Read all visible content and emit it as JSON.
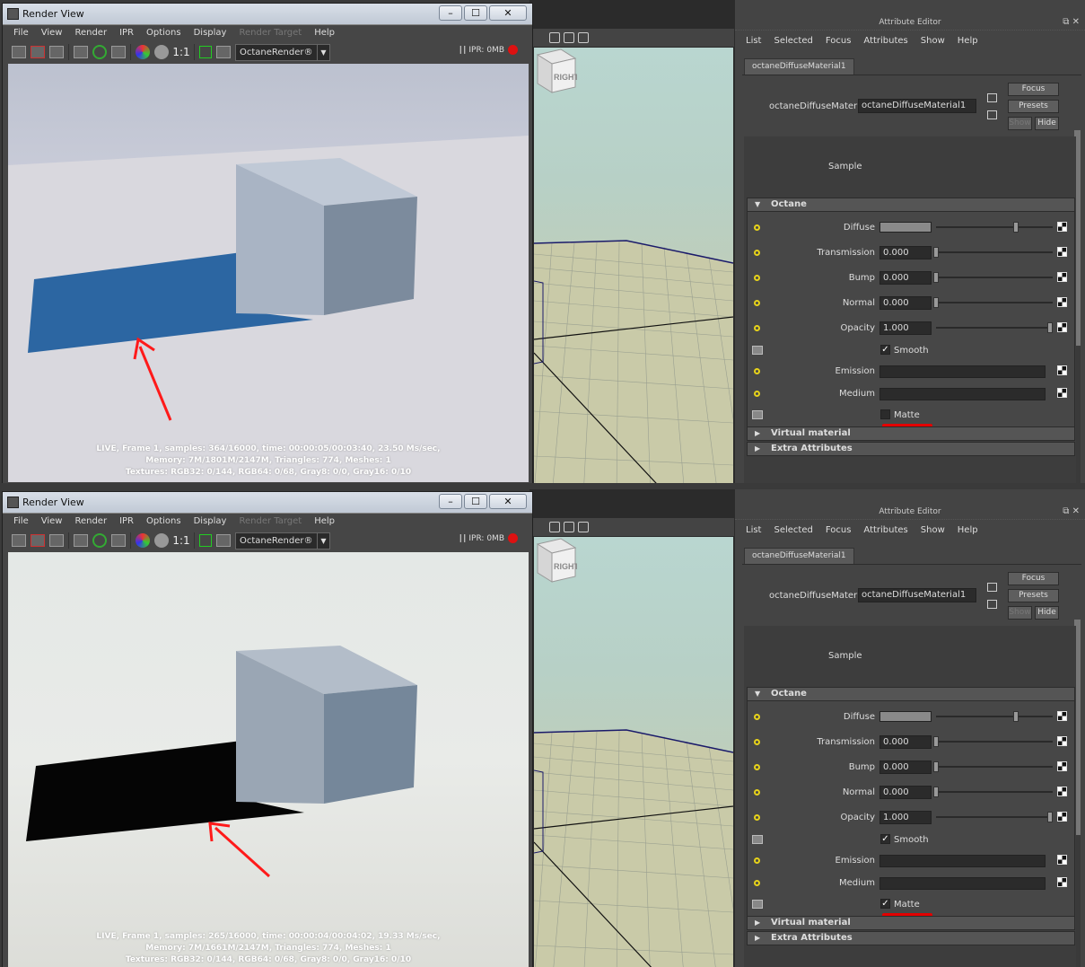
{
  "render_view": {
    "title": "Render View",
    "window_buttons": {
      "minimize": "–",
      "maximize": "☐",
      "close": "✕"
    },
    "menu": [
      "File",
      "View",
      "Render",
      "IPR",
      "Options",
      "Display",
      "Render Target",
      "Help"
    ],
    "renderer_select": "OctaneRender®",
    "zoom_label": "1:1",
    "ipr_label": "IPR: 0MB"
  },
  "attribute_editor": {
    "title": "Attribute Editor",
    "menu": [
      "List",
      "Selected",
      "Focus",
      "Attributes",
      "Show",
      "Help"
    ],
    "tab": "octaneDiffuseMaterial1",
    "node_type_label": "octaneDiffuseMaterial:",
    "node_name": "octaneDiffuseMaterial1",
    "buttons": {
      "focus": "Focus",
      "presets": "Presets",
      "show": "Show",
      "hide": "Hide"
    },
    "sample_label": "Sample",
    "section_octane": "Octane",
    "attrs": {
      "diffuse": "Diffuse",
      "transmission": "Transmission",
      "transmission_value": "0.000",
      "bump": "Bump",
      "bump_value": "0.000",
      "normal": "Normal",
      "normal_value": "0.000",
      "opacity": "Opacity",
      "opacity_value": "1.000",
      "smooth": "Smooth",
      "emission": "Emission",
      "medium": "Medium",
      "matte": "Matte"
    },
    "section_virtual": "Virtual material",
    "section_extra": "Extra Attributes"
  },
  "viewport": {
    "cube_label": "RIGHT"
  },
  "panels": [
    {
      "matte_checked": false,
      "checkmark": "",
      "stats": [
        "LIVE, Frame 1, samples: 364/16000, time: 00:00:05/00:03:40, 23.50 Ms/sec,",
        "Memory: 7M/1801M/2147M, Triangles: 774, Meshes: 1",
        "Textures: RGB32: 0/144, RGB64: 0/68, Gray8: 0/0, Gray16: 0/10"
      ]
    },
    {
      "matte_checked": true,
      "checkmark": "✓",
      "stats": [
        "LIVE, Frame 1, samples: 265/16000, time: 00:00:04/00:04:02, 19.33 Ms/sec,",
        "Memory: 7M/1661M/2147M, Triangles: 774, Meshes: 1",
        "Textures: RGB32: 0/144, RGB64: 0/68, Gray8: 0/0, Gray16: 0/10"
      ]
    }
  ],
  "colors": {
    "shadow_unmatte": "#2c66a2",
    "shadow_matte": "#050505",
    "annotation_red": "#ff1a1a",
    "attr_dot": "#e6d21a"
  }
}
